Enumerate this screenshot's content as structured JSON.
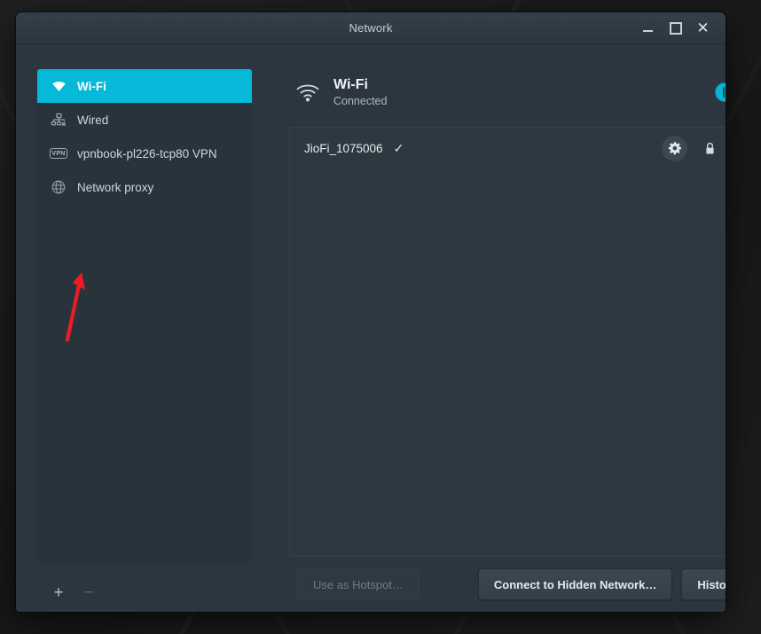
{
  "window": {
    "title": "Network",
    "controls": {
      "minimize": "minimize-button",
      "maximize": "maximize-button",
      "close": "close-button"
    }
  },
  "sidebar": {
    "items": [
      {
        "label": "Wi-Fi",
        "icon": "wifi-icon",
        "selected": true
      },
      {
        "label": "Wired",
        "icon": "wired-disconnected-icon",
        "selected": false
      },
      {
        "label": "vpnbook-pl226-tcp80 VPN",
        "icon": "vpn-badge-icon",
        "selected": false
      },
      {
        "label": "Network proxy",
        "icon": "globe-icon",
        "selected": false
      }
    ],
    "actions": {
      "add_label": "+",
      "remove_label": "−"
    }
  },
  "main": {
    "header": {
      "title": "Wi-Fi",
      "status": "Connected",
      "icon": "wifi-signal-icon",
      "toggle_state": "on"
    },
    "networks": [
      {
        "ssid": "JioFi_1075006",
        "connected_check": "✓",
        "settings_icon": "gear-icon",
        "secured_icon": "lock-icon",
        "signal_icon": "wifi-signal-full-icon"
      }
    ],
    "buttons": {
      "hotspot": "Use as Hotspot…",
      "hidden_network": "Connect to Hidden Network…",
      "history": "History"
    }
  },
  "annotation": {
    "arrow_color": "#ec1c24",
    "points_to": "Network proxy"
  },
  "colors": {
    "accent": "#06b9d9",
    "window_bg": "#2b3640",
    "sidebar_panel": "#29333c",
    "list_bg": "#2e3840",
    "titlebar": "#2c3741"
  }
}
